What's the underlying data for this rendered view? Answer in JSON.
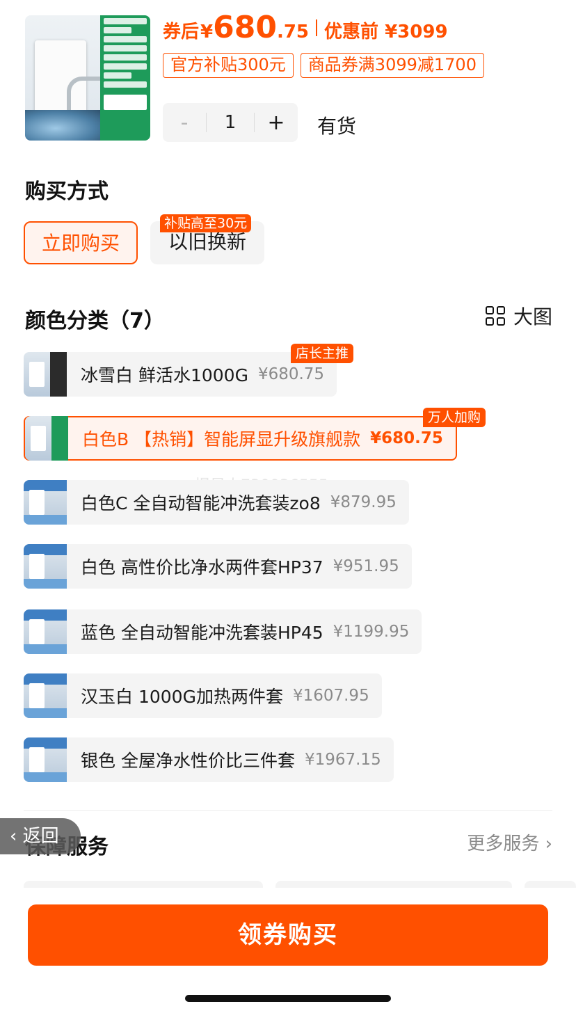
{
  "product": {
    "thumb_icon": "water-purifier-product-image"
  },
  "price": {
    "prefix": "券后",
    "symbol": "¥",
    "integer": "680",
    "decimal": ".75",
    "original_label": "优惠前 ¥3099"
  },
  "tags": [
    "官方补贴300元",
    "商品券满3099减1700"
  ],
  "stepper": {
    "minus": "-",
    "quantity": "1",
    "plus": "+"
  },
  "stock": "有货",
  "purchase_method": {
    "title": "购买方式",
    "options": [
      {
        "label": "立即购买",
        "selected": true
      },
      {
        "label": "以旧换新",
        "corner_badge": "补贴高至30元"
      }
    ]
  },
  "colors": {
    "title": "颜色分类（7）",
    "big_view_label": "大图",
    "big_view_icon": "grid-icon",
    "variants": [
      {
        "name": "冰雪白 鲜活水1000G",
        "price": "¥680.75",
        "badge": "店长主推",
        "selected": false
      },
      {
        "name": "白色B 【热销】智能屏显升级旗舰款",
        "price": "¥680.75",
        "badge": "万人加购",
        "selected": true
      },
      {
        "name": "白色C 全自动智能冲洗套装zo8",
        "price": "¥879.95"
      },
      {
        "name": "白色 高性价比净水两件套HP37",
        "price": "¥951.95"
      },
      {
        "name": "蓝色 全自动智能冲洗套装HP45",
        "price": "¥1199.95"
      },
      {
        "name": "汉玉白 1000G加热两件套",
        "price": "¥1607.95"
      },
      {
        "name": "银色 全屋净水性价比三件套",
        "price": "¥1967.15"
      }
    ]
  },
  "watermark": "慢星人730036555",
  "services": {
    "title": "保障服务",
    "more_label": "更多服务",
    "back_label": "返回"
  },
  "cta_label": "领券购买",
  "accent_color": "#ff5000"
}
